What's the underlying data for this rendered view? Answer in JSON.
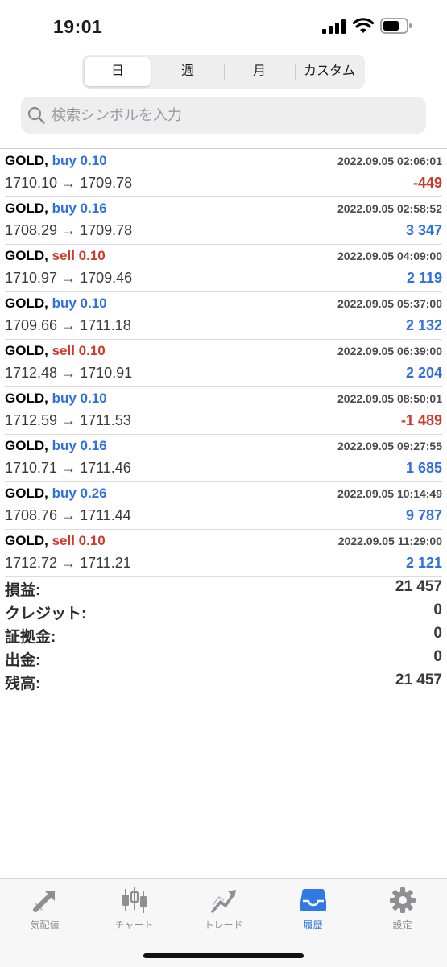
{
  "status_bar": {
    "time": "19:01"
  },
  "period_tabs": [
    {
      "label": "日",
      "active": true
    },
    {
      "label": "週",
      "active": false
    },
    {
      "label": "月",
      "active": false
    },
    {
      "label": "カスタム",
      "active": false
    }
  ],
  "search": {
    "placeholder": "検索シンボルを入力",
    "value": ""
  },
  "deals": [
    {
      "symbol": "GOLD,",
      "side": "buy",
      "volume": "0.10",
      "time": "2022.09.05 02:06:01",
      "prices": "1710.10 → 1709.78",
      "profit": "-449"
    },
    {
      "symbol": "GOLD,",
      "side": "buy",
      "volume": "0.16",
      "time": "2022.09.05 02:58:52",
      "prices": "1708.29 → 1709.78",
      "profit": "3 347"
    },
    {
      "symbol": "GOLD,",
      "side": "sell",
      "volume": "0.10",
      "time": "2022.09.05 04:09:00",
      "prices": "1710.97 → 1709.46",
      "profit": "2 119"
    },
    {
      "symbol": "GOLD,",
      "side": "buy",
      "volume": "0.10",
      "time": "2022.09.05 05:37:00",
      "prices": "1709.66 → 1711.18",
      "profit": "2 132"
    },
    {
      "symbol": "GOLD,",
      "side": "sell",
      "volume": "0.10",
      "time": "2022.09.05 06:39:00",
      "prices": "1712.48 → 1710.91",
      "profit": "2 204"
    },
    {
      "symbol": "GOLD,",
      "side": "buy",
      "volume": "0.10",
      "time": "2022.09.05 08:50:01",
      "prices": "1712.59 → 1711.53",
      "profit": "-1 489"
    },
    {
      "symbol": "GOLD,",
      "side": "buy",
      "volume": "0.16",
      "time": "2022.09.05 09:27:55",
      "prices": "1710.71 → 1711.46",
      "profit": "1 685"
    },
    {
      "symbol": "GOLD,",
      "side": "buy",
      "volume": "0.26",
      "time": "2022.09.05 10:14:49",
      "prices": "1708.76 → 1711.44",
      "profit": "9 787"
    },
    {
      "symbol": "GOLD,",
      "side": "sell",
      "volume": "0.10",
      "time": "2022.09.05 11:29:00",
      "prices": "1712.72 → 1711.21",
      "profit": "2 121"
    }
  ],
  "summary": [
    {
      "label": "損益:",
      "value": "21 457"
    },
    {
      "label": "クレジット:",
      "value": "0"
    },
    {
      "label": "証拠金:",
      "value": "0"
    },
    {
      "label": "出金:",
      "value": "0"
    },
    {
      "label": "残高:",
      "value": "21 457"
    }
  ],
  "tabbar": [
    {
      "label": "気配値",
      "icon": "quotes-arrow-icon",
      "active": false
    },
    {
      "label": "チャート",
      "icon": "candlestick-icon",
      "active": false
    },
    {
      "label": "トレード",
      "icon": "trade-trend-icon",
      "active": false
    },
    {
      "label": "履歴",
      "icon": "history-tray-icon",
      "active": true
    },
    {
      "label": "設定",
      "icon": "gear-icon",
      "active": false
    }
  ],
  "colors": {
    "buy": "#2f6fe0",
    "sell": "#d0392b",
    "accent": "#2f7ae5",
    "inactive": "#8e8e93"
  }
}
